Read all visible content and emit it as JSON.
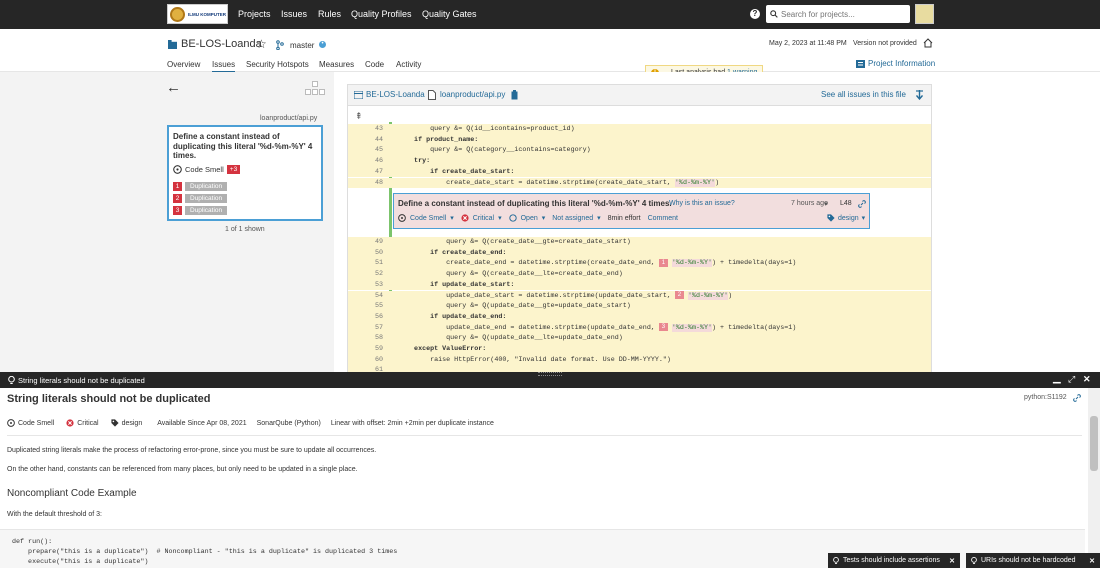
{
  "nav": {
    "items": [
      "Projects",
      "Issues",
      "Rules",
      "Quality Profiles",
      "Quality Gates"
    ],
    "search_placeholder": "Search for projects...",
    "logo_text": "ILMU KOMPUTER"
  },
  "project": {
    "name": "BE-LOS-Loanda",
    "branch": "master",
    "tabs": [
      "Overview",
      "Issues",
      "Security Hotspots",
      "Measures",
      "Code",
      "Activity"
    ],
    "warning_prefix": "Last analysis had ",
    "warning_link": "1 warning",
    "analysis_date": "May 2, 2023 at 11:48 PM",
    "version": "Version not provided",
    "project_info": "Project Information"
  },
  "sidebar": {
    "file": "loanproduct/api.py",
    "issue_title": "Define a constant instead of duplicating this literal '%d-%m-%Y' 4 times.",
    "type": "Code Smell",
    "badge": "+3",
    "locations": [
      {
        "n": "1",
        "label": "Duplication"
      },
      {
        "n": "2",
        "label": "Duplication"
      },
      {
        "n": "3",
        "label": "Duplication"
      }
    ],
    "count": "1 of 1 shown"
  },
  "code": {
    "crumb_project": "BE-LOS-Loanda",
    "crumb_file": "loanproduct/api.py",
    "see_all": "See all issues in this file",
    "lines_top": [
      {
        "n": "43",
        "code": "        query &= Q(id__icontains=product_id)"
      },
      {
        "n": "44",
        "code": "    if product_name:"
      },
      {
        "n": "45",
        "code": "        query &= Q(category__icontains=category)"
      },
      {
        "n": "46",
        "code": "    try:"
      },
      {
        "n": "47",
        "code": "        if create_date_start:"
      },
      {
        "n": "48",
        "code": "            create_date_start = datetime.strptime(create_date_start, "
      }
    ],
    "line48_str": "'%d-%m-%Y'",
    "line48_end": ")",
    "lines_bottom": [
      {
        "n": "49",
        "code": "            query &= Q(create_date__gte=create_date_start)"
      },
      {
        "n": "50",
        "code": "        if create_date_end:"
      },
      {
        "n": "51",
        "pre": "            create_date_end = datetime.strptime(create_date_end, ",
        "mark": "1",
        "str": "'%d-%m-%Y'",
        "post": ") + timedelta(days=1)"
      },
      {
        "n": "52",
        "code": "            query &= Q(create_date__lte=create_date_end)"
      },
      {
        "n": "53",
        "code": "        if update_date_start:"
      },
      {
        "n": "54",
        "pre": "            update_date_start = datetime.strptime(update_date_start, ",
        "mark": "2",
        "str": "'%d-%m-%Y'",
        "post": ")"
      },
      {
        "n": "55",
        "code": "            query &= Q(update_date__gte=update_date_start)"
      },
      {
        "n": "56",
        "code": "        if update_date_end:"
      },
      {
        "n": "57",
        "pre": "            update_date_end = datetime.strptime(update_date_end, ",
        "mark": "3",
        "str": "'%d-%m-%Y'",
        "post": ") + timedelta(days=1)"
      },
      {
        "n": "58",
        "code": "            query &= Q(update_date__lte=update_date_end)"
      },
      {
        "n": "59",
        "code": "    except ValueError:"
      },
      {
        "n": "60",
        "code": "        raise HttpError(400, \"Invalid date format. Use DD-MM-YYYY.\")"
      },
      {
        "n": "61",
        "code": ""
      }
    ]
  },
  "issue_box": {
    "title": "Define a constant instead of duplicating this literal '%d-%m-%Y' 4 times.",
    "why": "Why is this an issue?",
    "time": "7 hours ago",
    "line": "L48",
    "type": "Code Smell",
    "severity": "Critical",
    "status": "Open",
    "assignee": "Not assigned",
    "effort": "8min effort",
    "comment": "Comment",
    "tag": "design"
  },
  "rule": {
    "header": "String literals should not be duplicated",
    "title": "String literals should not be duplicated",
    "key": "python:S1192",
    "type": "Code Smell",
    "severity": "Critical",
    "tag": "design",
    "since": "Available Since Apr 08, 2021",
    "engine": "SonarQube (Python)",
    "remediation": "Linear with offset: 2min +2min per duplicate instance",
    "p1": "Duplicated string literals make the process of refactoring error-prone, since you must be sure to update all occurrences.",
    "p2": "On the other hand, constants can be referenced from many places, but only need to be updated in a single place.",
    "h2": "Noncompliant Code Example",
    "p3": "With the default threshold of 3:",
    "code": [
      "def run():",
      "    prepare(\"this is a duplicate\")  # Noncompliant - \"this is a duplicate\" is duplicated 3 times",
      "    execute(\"this is a duplicate\")"
    ]
  },
  "toasts": [
    "Tests should include assertions",
    "URIs should not be hardcoded"
  ],
  "colors": {
    "topbar": "#262626",
    "accent": "#236a97",
    "critical": "#d4333f",
    "issue_bg": "#f2dede",
    "highlight": "#fcf4cc",
    "warning": "#fcf8e3"
  }
}
